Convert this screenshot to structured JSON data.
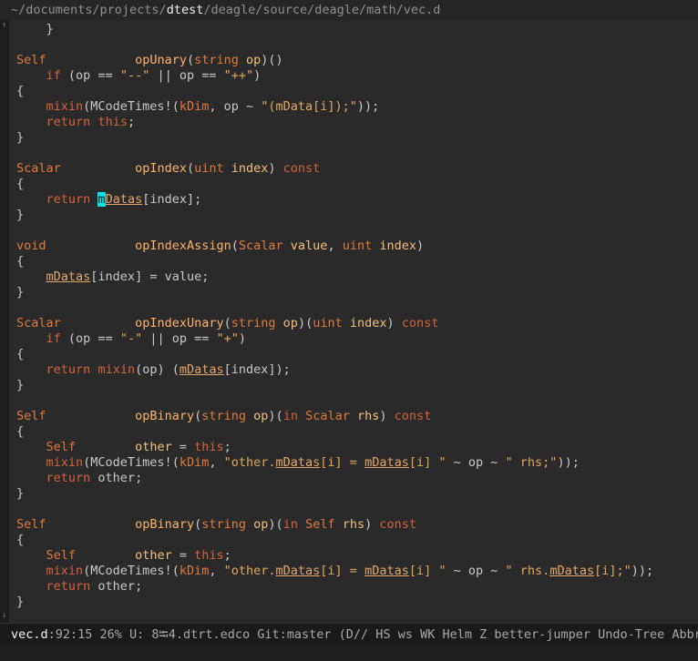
{
  "title": {
    "prefix": "~/documents/projects/",
    "project": "dtest",
    "suffix": "/deagle/source/deagle/math/vec.d"
  },
  "modeline": {
    "filename": "vec.d",
    "rest": ":92:15 26% U: 8⭾4.dtrt.edco Git:master (D// HS ws WK Helm Z better-jumper Undo-Tree Abbrev"
  },
  "code_lines": [
    [
      [
        "t-plain",
        "    }"
      ]
    ],
    [],
    [
      [
        "t-type",
        "Self"
      ],
      [
        "t-plain",
        "            "
      ],
      [
        "t-fn",
        "opUnary"
      ],
      [
        "t-plain",
        "("
      ],
      [
        "t-type",
        "string"
      ],
      [
        "t-plain",
        " "
      ],
      [
        "t-param",
        "op"
      ],
      [
        "t-plain",
        ")()"
      ]
    ],
    [
      [
        "t-plain",
        "    "
      ],
      [
        "t-kw",
        "if"
      ],
      [
        "t-plain",
        " (op == "
      ],
      [
        "t-str",
        "\"--\""
      ],
      [
        "t-plain",
        " || op == "
      ],
      [
        "t-str",
        "\"++\""
      ],
      [
        "t-plain",
        ")"
      ]
    ],
    [
      [
        "t-plain",
        "{"
      ]
    ],
    [
      [
        "t-plain",
        "    "
      ],
      [
        "t-kw",
        "mixin"
      ],
      [
        "t-plain",
        "(MCodeTimes!("
      ],
      [
        "t-type",
        "kDim"
      ],
      [
        "t-plain",
        ", op ~ "
      ],
      [
        "t-str",
        "\"(mData[i]);\""
      ],
      [
        "t-plain",
        "));"
      ]
    ],
    [
      [
        "t-plain",
        "    "
      ],
      [
        "t-kw",
        "return"
      ],
      [
        "t-plain",
        " "
      ],
      [
        "t-kw",
        "this"
      ],
      [
        "t-plain",
        ";"
      ]
    ],
    [
      [
        "t-plain",
        "}"
      ]
    ],
    [],
    [
      [
        "t-type",
        "Scalar"
      ],
      [
        "t-plain",
        "          "
      ],
      [
        "t-fn",
        "opIndex"
      ],
      [
        "t-plain",
        "("
      ],
      [
        "t-type",
        "uint"
      ],
      [
        "t-plain",
        " "
      ],
      [
        "t-param",
        "index"
      ],
      [
        "t-plain",
        ") "
      ],
      [
        "t-kw",
        "const"
      ]
    ],
    [
      [
        "t-plain",
        "{"
      ]
    ],
    [
      [
        "t-plain",
        "    "
      ],
      [
        "t-kw",
        "return"
      ],
      [
        "t-plain",
        " "
      ],
      [
        "t-cursor",
        "m"
      ],
      [
        "t-field",
        "Datas"
      ],
      [
        "t-plain",
        "[index];"
      ]
    ],
    [
      [
        "t-plain",
        "}"
      ]
    ],
    [],
    [
      [
        "t-type",
        "void"
      ],
      [
        "t-plain",
        "            "
      ],
      [
        "t-fn",
        "opIndexAssign"
      ],
      [
        "t-plain",
        "("
      ],
      [
        "t-type",
        "Scalar"
      ],
      [
        "t-plain",
        " "
      ],
      [
        "t-param",
        "value"
      ],
      [
        "t-plain",
        ", "
      ],
      [
        "t-type",
        "uint"
      ],
      [
        "t-plain",
        " "
      ],
      [
        "t-param",
        "index"
      ],
      [
        "t-plain",
        ")"
      ]
    ],
    [
      [
        "t-plain",
        "{"
      ]
    ],
    [
      [
        "t-plain",
        "    "
      ],
      [
        "t-field",
        "mDatas"
      ],
      [
        "t-plain",
        "[index] = value;"
      ]
    ],
    [
      [
        "t-plain",
        "}"
      ]
    ],
    [],
    [
      [
        "t-type",
        "Scalar"
      ],
      [
        "t-plain",
        "          "
      ],
      [
        "t-fn",
        "opIndexUnary"
      ],
      [
        "t-plain",
        "("
      ],
      [
        "t-type",
        "string"
      ],
      [
        "t-plain",
        " "
      ],
      [
        "t-param",
        "op"
      ],
      [
        "t-plain",
        ")("
      ],
      [
        "t-type",
        "uint"
      ],
      [
        "t-plain",
        " "
      ],
      [
        "t-param",
        "index"
      ],
      [
        "t-plain",
        ") "
      ],
      [
        "t-kw",
        "const"
      ]
    ],
    [
      [
        "t-plain",
        "    "
      ],
      [
        "t-kw",
        "if"
      ],
      [
        "t-plain",
        " (op == "
      ],
      [
        "t-str",
        "\"-\""
      ],
      [
        "t-plain",
        " || op == "
      ],
      [
        "t-str",
        "\"+\""
      ],
      [
        "t-plain",
        ")"
      ]
    ],
    [
      [
        "t-plain",
        "{"
      ]
    ],
    [
      [
        "t-plain",
        "    "
      ],
      [
        "t-kw",
        "return"
      ],
      [
        "t-plain",
        " "
      ],
      [
        "t-kw",
        "mixin"
      ],
      [
        "t-plain",
        "(op) ("
      ],
      [
        "t-field",
        "mDatas"
      ],
      [
        "t-plain",
        "[index]);"
      ]
    ],
    [
      [
        "t-plain",
        "}"
      ]
    ],
    [],
    [
      [
        "t-type",
        "Self"
      ],
      [
        "t-plain",
        "            "
      ],
      [
        "t-fn",
        "opBinary"
      ],
      [
        "t-plain",
        "("
      ],
      [
        "t-type",
        "string"
      ],
      [
        "t-plain",
        " "
      ],
      [
        "t-param",
        "op"
      ],
      [
        "t-plain",
        ")("
      ],
      [
        "t-kw",
        "in"
      ],
      [
        "t-plain",
        " "
      ],
      [
        "t-type",
        "Scalar"
      ],
      [
        "t-plain",
        " "
      ],
      [
        "t-param",
        "rhs"
      ],
      [
        "t-plain",
        ") "
      ],
      [
        "t-kw",
        "const"
      ]
    ],
    [
      [
        "t-plain",
        "{"
      ]
    ],
    [
      [
        "t-plain",
        "    "
      ],
      [
        "t-type",
        "Self"
      ],
      [
        "t-plain",
        "        "
      ],
      [
        "t-param",
        "other"
      ],
      [
        "t-plain",
        " = "
      ],
      [
        "t-kw",
        "this"
      ],
      [
        "t-plain",
        ";"
      ]
    ],
    [
      [
        "t-plain",
        "    "
      ],
      [
        "t-kw",
        "mixin"
      ],
      [
        "t-plain",
        "(MCodeTimes!("
      ],
      [
        "t-type",
        "kDim"
      ],
      [
        "t-plain",
        ", "
      ],
      [
        "t-str",
        "\"other."
      ],
      [
        "t-field",
        "mDatas"
      ],
      [
        "t-str",
        "[i] = "
      ],
      [
        "t-field",
        "mDatas"
      ],
      [
        "t-str",
        "[i] \""
      ],
      [
        "t-plain",
        " ~ op ~ "
      ],
      [
        "t-str",
        "\" rhs;\""
      ],
      [
        "t-plain",
        "));"
      ]
    ],
    [
      [
        "t-plain",
        "    "
      ],
      [
        "t-kw",
        "return"
      ],
      [
        "t-plain",
        " other;"
      ]
    ],
    [
      [
        "t-plain",
        "}"
      ]
    ],
    [],
    [
      [
        "t-type",
        "Self"
      ],
      [
        "t-plain",
        "            "
      ],
      [
        "t-fn",
        "opBinary"
      ],
      [
        "t-plain",
        "("
      ],
      [
        "t-type",
        "string"
      ],
      [
        "t-plain",
        " "
      ],
      [
        "t-param",
        "op"
      ],
      [
        "t-plain",
        ")("
      ],
      [
        "t-kw",
        "in"
      ],
      [
        "t-plain",
        " "
      ],
      [
        "t-type",
        "Self"
      ],
      [
        "t-plain",
        " "
      ],
      [
        "t-param",
        "rhs"
      ],
      [
        "t-plain",
        ") "
      ],
      [
        "t-kw",
        "const"
      ]
    ],
    [
      [
        "t-plain",
        "{"
      ]
    ],
    [
      [
        "t-plain",
        "    "
      ],
      [
        "t-type",
        "Self"
      ],
      [
        "t-plain",
        "        "
      ],
      [
        "t-param",
        "other"
      ],
      [
        "t-plain",
        " = "
      ],
      [
        "t-kw",
        "this"
      ],
      [
        "t-plain",
        ";"
      ]
    ],
    [
      [
        "t-plain",
        "    "
      ],
      [
        "t-kw",
        "mixin"
      ],
      [
        "t-plain",
        "(MCodeTimes!("
      ],
      [
        "t-type",
        "kDim"
      ],
      [
        "t-plain",
        ", "
      ],
      [
        "t-str",
        "\"other."
      ],
      [
        "t-field",
        "mDatas"
      ],
      [
        "t-str",
        "[i] = "
      ],
      [
        "t-field",
        "mDatas"
      ],
      [
        "t-str",
        "[i] \""
      ],
      [
        "t-plain",
        " ~ op ~ "
      ],
      [
        "t-str",
        "\" rhs."
      ],
      [
        "t-field",
        "mDatas"
      ],
      [
        "t-str",
        "[i];\""
      ],
      [
        "t-plain",
        "));"
      ]
    ],
    [
      [
        "t-plain",
        "    "
      ],
      [
        "t-kw",
        "return"
      ],
      [
        "t-plain",
        " other;"
      ]
    ],
    [
      [
        "t-plain",
        "}"
      ]
    ]
  ]
}
